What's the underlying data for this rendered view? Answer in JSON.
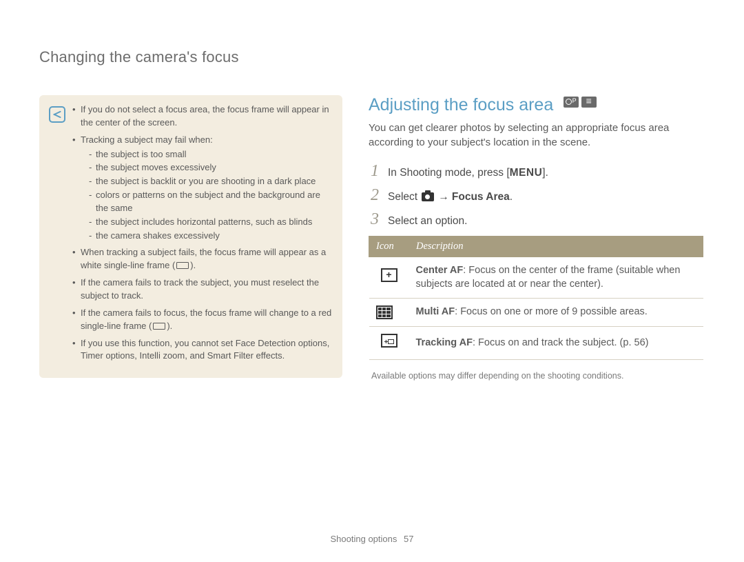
{
  "header": {
    "title": "Changing the camera's focus"
  },
  "note": {
    "items": [
      {
        "text": "If you do not select a focus area, the focus frame will appear in the center of the screen."
      },
      {
        "text": "Tracking a subject may fail when:",
        "sub": [
          "the subject is too small",
          "the subject moves excessively",
          "the subject is backlit or you are shooting in a dark place",
          "colors or patterns on the subject and the background are the same",
          "the subject includes horizontal patterns, such as blinds",
          "the camera shakes excessively"
        ]
      },
      {
        "text_pre": "When tracking a subject fails, the focus frame will appear as a white single-line frame (",
        "text_post": ")."
      },
      {
        "text": "If the camera fails to track the subject, you must reselect the subject to track."
      },
      {
        "text_pre": "If the camera fails to focus, the focus frame will change to a red single-line frame (",
        "text_post": ")."
      },
      {
        "text": "If you use this function, you cannot set Face Detection options, Timer options, Intelli zoom, and Smart Filter effects."
      }
    ]
  },
  "section": {
    "title": "Adjusting the focus area",
    "intro": "You can get clearer photos by selecting an appropriate focus area according to your subject's location in the scene.",
    "steps": [
      {
        "n": "1",
        "pre": "In Shooting mode, press [",
        "menu": "MENU",
        "post": "]."
      },
      {
        "n": "2",
        "pre": "Select ",
        "arrow": "→",
        "bold": "Focus Area",
        "post": "."
      },
      {
        "n": "3",
        "text": "Select an option."
      }
    ],
    "table": {
      "head": {
        "icon": "Icon",
        "desc": "Description"
      },
      "rows": [
        {
          "name": "Center AF",
          "desc": ": Focus on the center of the frame (suitable when subjects are located at or near the center)."
        },
        {
          "name": "Multi AF",
          "desc": ": Focus on one or more of 9 possible areas."
        },
        {
          "name": "Tracking AF",
          "desc": ": Focus on and track the subject. (p. 56)"
        }
      ]
    },
    "table_note": "Available options may differ depending on the shooting conditions."
  },
  "footer": {
    "section": "Shooting options",
    "page": "57"
  }
}
